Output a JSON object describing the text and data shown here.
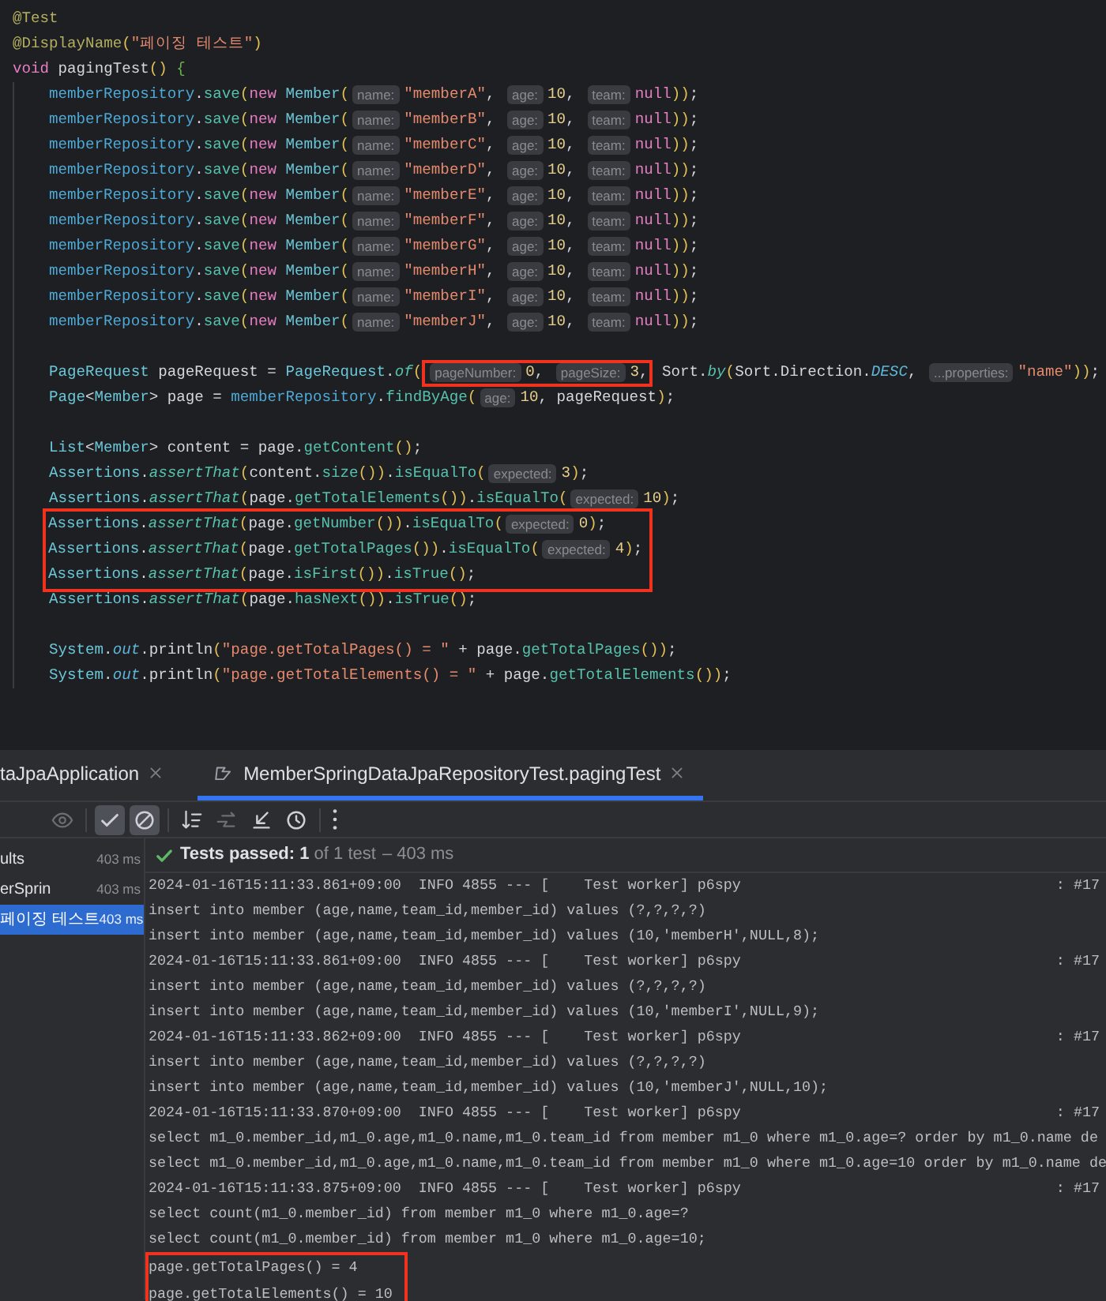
{
  "editor": {
    "lines": [
      {
        "kind": "code",
        "highlighted": false,
        "tokens": [
          {
            "kind": "annot",
            "text": "@Test"
          }
        ]
      },
      {
        "kind": "code",
        "highlighted": false,
        "tokens": [
          {
            "kind": "annot",
            "text": "@DisplayName"
          },
          {
            "kind": "paren",
            "text": "("
          },
          {
            "kind": "str",
            "text": "\"페이징 테스트\""
          },
          {
            "kind": "paren",
            "text": ")"
          }
        ]
      },
      {
        "kind": "code",
        "highlighted": false,
        "tokens": [
          {
            "kind": "kw",
            "text": "void "
          },
          {
            "kind": "plain",
            "text": "pagingTest"
          },
          {
            "kind": "paren",
            "text": "() "
          },
          {
            "kind": "brace",
            "text": "{"
          }
        ],
        "children": [
          {
            "kind": "code",
            "highlighted": false,
            "tokens": [
              {
                "kind": "field",
                "text": "memberRepository"
              },
              {
                "kind": "plain",
                "text": "."
              },
              {
                "kind": "method",
                "text": "save"
              },
              {
                "kind": "paren",
                "text": "("
              },
              {
                "kind": "kw",
                "text": "new "
              },
              {
                "kind": "cls",
                "text": "Member"
              },
              {
                "kind": "paren",
                "text": "("
              },
              {
                "kind": "hint",
                "text": "name:"
              },
              {
                "kind": "str",
                "text": "\"memberA\""
              },
              {
                "kind": "plain",
                "text": ", "
              },
              {
                "kind": "hint",
                "text": "age:"
              },
              {
                "kind": "num",
                "text": "10"
              },
              {
                "kind": "plain",
                "text": ", "
              },
              {
                "kind": "hint",
                "text": "team:"
              },
              {
                "kind": "kw",
                "text": "null"
              },
              {
                "kind": "paren",
                "text": "))"
              },
              {
                "kind": "plain",
                "text": ";"
              }
            ]
          },
          {
            "kind": "code",
            "highlighted": false,
            "tokens": [
              {
                "kind": "field",
                "text": "memberRepository"
              },
              {
                "kind": "plain",
                "text": "."
              },
              {
                "kind": "method",
                "text": "save"
              },
              {
                "kind": "paren",
                "text": "("
              },
              {
                "kind": "kw",
                "text": "new "
              },
              {
                "kind": "cls",
                "text": "Member"
              },
              {
                "kind": "paren",
                "text": "("
              },
              {
                "kind": "hint",
                "text": "name:"
              },
              {
                "kind": "str",
                "text": "\"memberB\""
              },
              {
                "kind": "plain",
                "text": ", "
              },
              {
                "kind": "hint",
                "text": "age:"
              },
              {
                "kind": "num",
                "text": "10"
              },
              {
                "kind": "plain",
                "text": ", "
              },
              {
                "kind": "hint",
                "text": "team:"
              },
              {
                "kind": "kw",
                "text": "null"
              },
              {
                "kind": "paren",
                "text": "))"
              },
              {
                "kind": "plain",
                "text": ";"
              }
            ]
          },
          {
            "kind": "code",
            "highlighted": false,
            "tokens": [
              {
                "kind": "field",
                "text": "memberRepository"
              },
              {
                "kind": "plain",
                "text": "."
              },
              {
                "kind": "method",
                "text": "save"
              },
              {
                "kind": "paren",
                "text": "("
              },
              {
                "kind": "kw",
                "text": "new "
              },
              {
                "kind": "cls",
                "text": "Member"
              },
              {
                "kind": "paren",
                "text": "("
              },
              {
                "kind": "hint",
                "text": "name:"
              },
              {
                "kind": "str",
                "text": "\"memberC\""
              },
              {
                "kind": "plain",
                "text": ", "
              },
              {
                "kind": "hint",
                "text": "age:"
              },
              {
                "kind": "num",
                "text": "10"
              },
              {
                "kind": "plain",
                "text": ", "
              },
              {
                "kind": "hint",
                "text": "team:"
              },
              {
                "kind": "kw",
                "text": "null"
              },
              {
                "kind": "paren",
                "text": "))"
              },
              {
                "kind": "plain",
                "text": ";"
              }
            ]
          },
          {
            "kind": "code",
            "highlighted": false,
            "tokens": [
              {
                "kind": "field",
                "text": "memberRepository"
              },
              {
                "kind": "plain",
                "text": "."
              },
              {
                "kind": "method",
                "text": "save"
              },
              {
                "kind": "paren",
                "text": "("
              },
              {
                "kind": "kw",
                "text": "new "
              },
              {
                "kind": "cls",
                "text": "Member"
              },
              {
                "kind": "paren",
                "text": "("
              },
              {
                "kind": "hint",
                "text": "name:"
              },
              {
                "kind": "str",
                "text": "\"memberD\""
              },
              {
                "kind": "plain",
                "text": ", "
              },
              {
                "kind": "hint",
                "text": "age:"
              },
              {
                "kind": "num",
                "text": "10"
              },
              {
                "kind": "plain",
                "text": ", "
              },
              {
                "kind": "hint",
                "text": "team:"
              },
              {
                "kind": "kw",
                "text": "null"
              },
              {
                "kind": "paren",
                "text": "))"
              },
              {
                "kind": "plain",
                "text": ";"
              }
            ]
          },
          {
            "kind": "code",
            "highlighted": false,
            "tokens": [
              {
                "kind": "field",
                "text": "memberRepository"
              },
              {
                "kind": "plain",
                "text": "."
              },
              {
                "kind": "method",
                "text": "save"
              },
              {
                "kind": "paren",
                "text": "("
              },
              {
                "kind": "kw",
                "text": "new "
              },
              {
                "kind": "cls",
                "text": "Member"
              },
              {
                "kind": "paren",
                "text": "("
              },
              {
                "kind": "hint",
                "text": "name:"
              },
              {
                "kind": "str",
                "text": "\"memberE\""
              },
              {
                "kind": "plain",
                "text": ", "
              },
              {
                "kind": "hint",
                "text": "age:"
              },
              {
                "kind": "num",
                "text": "10"
              },
              {
                "kind": "plain",
                "text": ", "
              },
              {
                "kind": "hint",
                "text": "team:"
              },
              {
                "kind": "kw",
                "text": "null"
              },
              {
                "kind": "paren",
                "text": "))"
              },
              {
                "kind": "plain",
                "text": ";"
              }
            ]
          },
          {
            "kind": "code",
            "highlighted": false,
            "tokens": [
              {
                "kind": "field",
                "text": "memberRepository"
              },
              {
                "kind": "plain",
                "text": "."
              },
              {
                "kind": "method",
                "text": "save"
              },
              {
                "kind": "paren",
                "text": "("
              },
              {
                "kind": "kw",
                "text": "new "
              },
              {
                "kind": "cls",
                "text": "Member"
              },
              {
                "kind": "paren",
                "text": "("
              },
              {
                "kind": "hint",
                "text": "name:"
              },
              {
                "kind": "str",
                "text": "\"memberF\""
              },
              {
                "kind": "plain",
                "text": ", "
              },
              {
                "kind": "hint",
                "text": "age:"
              },
              {
                "kind": "num",
                "text": "10"
              },
              {
                "kind": "plain",
                "text": ", "
              },
              {
                "kind": "hint",
                "text": "team:"
              },
              {
                "kind": "kw",
                "text": "null"
              },
              {
                "kind": "paren",
                "text": "))"
              },
              {
                "kind": "plain",
                "text": ";"
              }
            ]
          },
          {
            "kind": "code",
            "highlighted": false,
            "tokens": [
              {
                "kind": "field",
                "text": "memberRepository"
              },
              {
                "kind": "plain",
                "text": "."
              },
              {
                "kind": "method",
                "text": "save"
              },
              {
                "kind": "paren",
                "text": "("
              },
              {
                "kind": "kw",
                "text": "new "
              },
              {
                "kind": "cls",
                "text": "Member"
              },
              {
                "kind": "paren",
                "text": "("
              },
              {
                "kind": "hint",
                "text": "name:"
              },
              {
                "kind": "str",
                "text": "\"memberG\""
              },
              {
                "kind": "plain",
                "text": ", "
              },
              {
                "kind": "hint",
                "text": "age:"
              },
              {
                "kind": "num",
                "text": "10"
              },
              {
                "kind": "plain",
                "text": ", "
              },
              {
                "kind": "hint",
                "text": "team:"
              },
              {
                "kind": "kw",
                "text": "null"
              },
              {
                "kind": "paren",
                "text": "))"
              },
              {
                "kind": "plain",
                "text": ";"
              }
            ]
          },
          {
            "kind": "code",
            "highlighted": false,
            "tokens": [
              {
                "kind": "field",
                "text": "memberRepository"
              },
              {
                "kind": "plain",
                "text": "."
              },
              {
                "kind": "method",
                "text": "save"
              },
              {
                "kind": "paren",
                "text": "("
              },
              {
                "kind": "kw",
                "text": "new "
              },
              {
                "kind": "cls",
                "text": "Member"
              },
              {
                "kind": "paren",
                "text": "("
              },
              {
                "kind": "hint",
                "text": "name:"
              },
              {
                "kind": "str",
                "text": "\"memberH\""
              },
              {
                "kind": "plain",
                "text": ", "
              },
              {
                "kind": "hint",
                "text": "age:"
              },
              {
                "kind": "num",
                "text": "10"
              },
              {
                "kind": "plain",
                "text": ", "
              },
              {
                "kind": "hint",
                "text": "team:"
              },
              {
                "kind": "kw",
                "text": "null"
              },
              {
                "kind": "paren",
                "text": "))"
              },
              {
                "kind": "plain",
                "text": ";"
              }
            ]
          },
          {
            "kind": "code",
            "highlighted": false,
            "tokens": [
              {
                "kind": "field",
                "text": "memberRepository"
              },
              {
                "kind": "plain",
                "text": "."
              },
              {
                "kind": "method",
                "text": "save"
              },
              {
                "kind": "paren",
                "text": "("
              },
              {
                "kind": "kw",
                "text": "new "
              },
              {
                "kind": "cls",
                "text": "Member"
              },
              {
                "kind": "paren",
                "text": "("
              },
              {
                "kind": "hint",
                "text": "name:"
              },
              {
                "kind": "str",
                "text": "\"memberI\""
              },
              {
                "kind": "plain",
                "text": ", "
              },
              {
                "kind": "hint",
                "text": "age:"
              },
              {
                "kind": "num",
                "text": "10"
              },
              {
                "kind": "plain",
                "text": ", "
              },
              {
                "kind": "hint",
                "text": "team:"
              },
              {
                "kind": "kw",
                "text": "null"
              },
              {
                "kind": "paren",
                "text": "))"
              },
              {
                "kind": "plain",
                "text": ";"
              }
            ]
          },
          {
            "kind": "code",
            "highlighted": false,
            "tokens": [
              {
                "kind": "field",
                "text": "memberRepository"
              },
              {
                "kind": "plain",
                "text": "."
              },
              {
                "kind": "method",
                "text": "save"
              },
              {
                "kind": "paren",
                "text": "("
              },
              {
                "kind": "kw",
                "text": "new "
              },
              {
                "kind": "cls",
                "text": "Member"
              },
              {
                "kind": "paren",
                "text": "("
              },
              {
                "kind": "hint",
                "text": "name:"
              },
              {
                "kind": "str",
                "text": "\"memberJ\""
              },
              {
                "kind": "plain",
                "text": ", "
              },
              {
                "kind": "hint",
                "text": "age:"
              },
              {
                "kind": "num",
                "text": "10"
              },
              {
                "kind": "plain",
                "text": ", "
              },
              {
                "kind": "hint",
                "text": "team:"
              },
              {
                "kind": "kw",
                "text": "null"
              },
              {
                "kind": "paren",
                "text": "))"
              },
              {
                "kind": "plain",
                "text": ";"
              }
            ]
          },
          {
            "kind": "blank"
          },
          {
            "kind": "code",
            "highlighted": false,
            "tokens": [
              {
                "kind": "cls",
                "text": "PageRequest"
              },
              {
                "kind": "plain",
                "text": " pageRequest = "
              },
              {
                "kind": "cls",
                "text": "PageRequest"
              },
              {
                "kind": "plain",
                "text": "."
              },
              {
                "kind": "static",
                "text": "of"
              },
              {
                "kind": "paren",
                "text": "("
              },
              {
                "kind": "hint",
                "text": "pageNumber:",
                "boxed": true
              },
              {
                "kind": "num",
                "text": "0",
                "boxed": true
              },
              {
                "kind": "plain",
                "text": ", ",
                "boxed": true
              },
              {
                "kind": "hint",
                "text": "pageSize:",
                "boxed": true
              },
              {
                "kind": "num",
                "text": "3",
                "boxed": true
              },
              {
                "kind": "plain",
                "text": ",",
                "boxed": true
              },
              {
                "kind": "plain",
                "text": " Sort."
              },
              {
                "kind": "static",
                "text": "by"
              },
              {
                "kind": "paren",
                "text": "("
              },
              {
                "kind": "plain",
                "text": "Sort.Direction."
              },
              {
                "kind": "const",
                "text": "DESC"
              },
              {
                "kind": "plain",
                "text": ", "
              },
              {
                "kind": "hint",
                "text": "...properties:"
              },
              {
                "kind": "str",
                "text": "\"name\""
              },
              {
                "kind": "paren",
                "text": "))"
              },
              {
                "kind": "plain",
                "text": ";"
              }
            ]
          },
          {
            "kind": "code",
            "highlighted": false,
            "tokens": [
              {
                "kind": "cls",
                "text": "Page"
              },
              {
                "kind": "plain",
                "text": "<"
              },
              {
                "kind": "cls",
                "text": "Member"
              },
              {
                "kind": "plain",
                "text": "> page = "
              },
              {
                "kind": "field",
                "text": "memberRepository"
              },
              {
                "kind": "plain",
                "text": "."
              },
              {
                "kind": "method",
                "text": "findByAge"
              },
              {
                "kind": "paren",
                "text": "("
              },
              {
                "kind": "hint",
                "text": "age:"
              },
              {
                "kind": "num",
                "text": "10"
              },
              {
                "kind": "plain",
                "text": ", pageRequest"
              },
              {
                "kind": "paren",
                "text": ")"
              },
              {
                "kind": "plain",
                "text": ";"
              }
            ]
          },
          {
            "kind": "blank"
          },
          {
            "kind": "code",
            "highlighted": false,
            "tokens": [
              {
                "kind": "cls",
                "text": "List"
              },
              {
                "kind": "plain",
                "text": "<"
              },
              {
                "kind": "cls",
                "text": "Member"
              },
              {
                "kind": "plain",
                "text": "> content = page."
              },
              {
                "kind": "method",
                "text": "getContent"
              },
              {
                "kind": "paren",
                "text": "()"
              },
              {
                "kind": "plain",
                "text": ";"
              }
            ]
          },
          {
            "kind": "code",
            "highlighted": false,
            "tokens": [
              {
                "kind": "cls",
                "text": "Assertions"
              },
              {
                "kind": "plain",
                "text": "."
              },
              {
                "kind": "static",
                "text": "assertThat"
              },
              {
                "kind": "paren",
                "text": "("
              },
              {
                "kind": "plain",
                "text": "content."
              },
              {
                "kind": "method",
                "text": "size"
              },
              {
                "kind": "paren",
                "text": "())"
              },
              {
                "kind": "plain",
                "text": "."
              },
              {
                "kind": "method",
                "text": "isEqualTo"
              },
              {
                "kind": "paren",
                "text": "("
              },
              {
                "kind": "hint",
                "text": "expected:"
              },
              {
                "kind": "num",
                "text": "3"
              },
              {
                "kind": "paren",
                "text": ")"
              },
              {
                "kind": "plain",
                "text": ";"
              }
            ]
          },
          {
            "kind": "code",
            "highlighted": false,
            "tokens": [
              {
                "kind": "cls",
                "text": "Assertions"
              },
              {
                "kind": "plain",
                "text": "."
              },
              {
                "kind": "static",
                "text": "assertThat"
              },
              {
                "kind": "paren",
                "text": "("
              },
              {
                "kind": "plain",
                "text": "page."
              },
              {
                "kind": "method",
                "text": "getTotalElements"
              },
              {
                "kind": "paren",
                "text": "())"
              },
              {
                "kind": "plain",
                "text": "."
              },
              {
                "kind": "method",
                "text": "isEqualTo"
              },
              {
                "kind": "paren",
                "text": "("
              },
              {
                "kind": "hint",
                "text": "expected:"
              },
              {
                "kind": "num",
                "text": "10"
              },
              {
                "kind": "paren",
                "text": ")"
              },
              {
                "kind": "plain",
                "text": ";"
              }
            ]
          },
          {
            "kind": "code",
            "highlighted": true,
            "tokens": [
              {
                "kind": "cls",
                "text": "Assertions"
              },
              {
                "kind": "plain",
                "text": "."
              },
              {
                "kind": "static",
                "text": "assertThat"
              },
              {
                "kind": "paren",
                "text": "("
              },
              {
                "kind": "plain",
                "text": "page."
              },
              {
                "kind": "method",
                "text": "getNumber"
              },
              {
                "kind": "paren",
                "text": "())"
              },
              {
                "kind": "plain",
                "text": "."
              },
              {
                "kind": "method",
                "text": "isEqualTo"
              },
              {
                "kind": "paren",
                "text": "("
              },
              {
                "kind": "hint",
                "text": "expected:"
              },
              {
                "kind": "num",
                "text": "0"
              },
              {
                "kind": "paren",
                "text": ")"
              },
              {
                "kind": "plain",
                "text": ";"
              }
            ]
          },
          {
            "kind": "code",
            "highlighted": true,
            "tokens": [
              {
                "kind": "cls",
                "text": "Assertions"
              },
              {
                "kind": "plain",
                "text": "."
              },
              {
                "kind": "static",
                "text": "assertThat"
              },
              {
                "kind": "paren",
                "text": "("
              },
              {
                "kind": "plain",
                "text": "page."
              },
              {
                "kind": "method",
                "text": "getTotalPages"
              },
              {
                "kind": "paren",
                "text": "())"
              },
              {
                "kind": "plain",
                "text": "."
              },
              {
                "kind": "method",
                "text": "isEqualTo"
              },
              {
                "kind": "paren",
                "text": "("
              },
              {
                "kind": "hint",
                "text": "expected:"
              },
              {
                "kind": "num",
                "text": "4"
              },
              {
                "kind": "paren",
                "text": ")"
              },
              {
                "kind": "plain",
                "text": ";"
              }
            ]
          },
          {
            "kind": "code",
            "highlighted": true,
            "tokens": [
              {
                "kind": "cls",
                "text": "Assertions"
              },
              {
                "kind": "plain",
                "text": "."
              },
              {
                "kind": "static",
                "text": "assertThat"
              },
              {
                "kind": "paren",
                "text": "("
              },
              {
                "kind": "plain",
                "text": "page."
              },
              {
                "kind": "method",
                "text": "isFirst"
              },
              {
                "kind": "paren",
                "text": "())"
              },
              {
                "kind": "plain",
                "text": "."
              },
              {
                "kind": "method",
                "text": "isTrue"
              },
              {
                "kind": "paren",
                "text": "()"
              },
              {
                "kind": "plain",
                "text": ";"
              }
            ]
          },
          {
            "kind": "code",
            "highlighted": false,
            "tokens": [
              {
                "kind": "cls",
                "text": "Assertions"
              },
              {
                "kind": "plain",
                "text": "."
              },
              {
                "kind": "static",
                "text": "assertThat"
              },
              {
                "kind": "paren",
                "text": "("
              },
              {
                "kind": "plain",
                "text": "page."
              },
              {
                "kind": "method",
                "text": "hasNext"
              },
              {
                "kind": "paren",
                "text": "())"
              },
              {
                "kind": "plain",
                "text": "."
              },
              {
                "kind": "method",
                "text": "isTrue"
              },
              {
                "kind": "paren",
                "text": "()"
              },
              {
                "kind": "plain",
                "text": ";"
              }
            ]
          },
          {
            "kind": "blank"
          },
          {
            "kind": "code",
            "highlighted": false,
            "tokens": [
              {
                "kind": "cls",
                "text": "System"
              },
              {
                "kind": "plain",
                "text": "."
              },
              {
                "kind": "const",
                "text": "out"
              },
              {
                "kind": "plain",
                "text": ".println"
              },
              {
                "kind": "paren",
                "text": "("
              },
              {
                "kind": "str",
                "text": "\"page.getTotalPages() = \""
              },
              {
                "kind": "plain",
                "text": " + page."
              },
              {
                "kind": "method",
                "text": "getTotalPages"
              },
              {
                "kind": "paren",
                "text": "())"
              },
              {
                "kind": "plain",
                "text": ";"
              }
            ]
          },
          {
            "kind": "code",
            "highlighted": false,
            "tokens": [
              {
                "kind": "cls",
                "text": "System"
              },
              {
                "kind": "plain",
                "text": "."
              },
              {
                "kind": "const",
                "text": "out"
              },
              {
                "kind": "plain",
                "text": ".println"
              },
              {
                "kind": "paren",
                "text": "("
              },
              {
                "kind": "str",
                "text": "\"page.getTotalElements() = \""
              },
              {
                "kind": "plain",
                "text": " + page."
              },
              {
                "kind": "method",
                "text": "getTotalElements"
              },
              {
                "kind": "paren",
                "text": "())"
              },
              {
                "kind": "plain",
                "text": ";"
              }
            ]
          }
        ]
      }
    ]
  },
  "tabs": [
    {
      "label": "taJpaApplication",
      "kind": "app",
      "selected": false
    },
    {
      "label": "MemberSpringDataJpaRepositoryTest.pagingTest",
      "kind": "test",
      "selected": true
    }
  ],
  "toolbar": [
    {
      "kind": "eye",
      "on": false,
      "disabled": true
    },
    {
      "kind": "check",
      "on": true,
      "disabled": false
    },
    {
      "kind": "stop",
      "on": true,
      "disabled": false
    },
    {
      "kind": "sort",
      "on": false,
      "disabled": false
    },
    {
      "kind": "export",
      "on": false,
      "disabled": true
    },
    {
      "kind": "import",
      "on": false,
      "disabled": false
    },
    {
      "kind": "history",
      "on": false,
      "disabled": false
    },
    {
      "kind": "more",
      "on": false,
      "disabled": false
    }
  ],
  "test_tree": [
    {
      "label": "ults",
      "time": "403 ms",
      "selected": false
    },
    {
      "label": "erSprin",
      "time": "403 ms",
      "selected": false
    },
    {
      "label": "페이징 테스트",
      "time": "403 ms",
      "selected": true
    }
  ],
  "status": {
    "text": "**Tests passed: 1** of 1 test",
    "duration": "– 403 ms"
  },
  "console": [
    {
      "text": "2024-01-16T15:11:33.861+09:00  INFO 4855 --- [    Test worker] p6spy",
      "tail": ": #17",
      "highlighted": false
    },
    {
      "text": "insert into member (age,name,team_id,member_id) values (?,?,?,?)",
      "highlighted": false
    },
    {
      "text": "insert into member (age,name,team_id,member_id) values (10,'memberH',NULL,8);",
      "highlighted": false
    },
    {
      "text": "2024-01-16T15:11:33.861+09:00  INFO 4855 --- [    Test worker] p6spy",
      "tail": ": #17",
      "highlighted": false
    },
    {
      "text": "insert into member (age,name,team_id,member_id) values (?,?,?,?)",
      "highlighted": false
    },
    {
      "text": "insert into member (age,name,team_id,member_id) values (10,'memberI',NULL,9);",
      "highlighted": false
    },
    {
      "text": "2024-01-16T15:11:33.862+09:00  INFO 4855 --- [    Test worker] p6spy",
      "tail": ": #17",
      "highlighted": false
    },
    {
      "text": "insert into member (age,name,team_id,member_id) values (?,?,?,?)",
      "highlighted": false
    },
    {
      "text": "insert into member (age,name,team_id,member_id) values (10,'memberJ',NULL,10);",
      "highlighted": false
    },
    {
      "text": "2024-01-16T15:11:33.870+09:00  INFO 4855 --- [    Test worker] p6spy",
      "tail": ": #17",
      "highlighted": false
    },
    {
      "text": "select m1_0.member_id,m1_0.age,m1_0.name,m1_0.team_id from member m1_0 where m1_0.age=? order by m1_0.name de",
      "highlighted": false
    },
    {
      "text": "select m1_0.member_id,m1_0.age,m1_0.name,m1_0.team_id from member m1_0 where m1_0.age=10 order by m1_0.name de",
      "highlighted": false
    },
    {
      "text": "2024-01-16T15:11:33.875+09:00  INFO 4855 --- [    Test worker] p6spy",
      "tail": ": #17",
      "highlighted": false
    },
    {
      "text": "select count(m1_0.member_id) from member m1_0 where m1_0.age=?",
      "highlighted": false
    },
    {
      "text": "select count(m1_0.member_id) from member m1_0 where m1_0.age=10;",
      "highlighted": false
    },
    {
      "text": "page.getTotalPages() = 4",
      "highlighted": true
    },
    {
      "text": "page.getTotalElements() = 10",
      "highlighted": true
    }
  ]
}
